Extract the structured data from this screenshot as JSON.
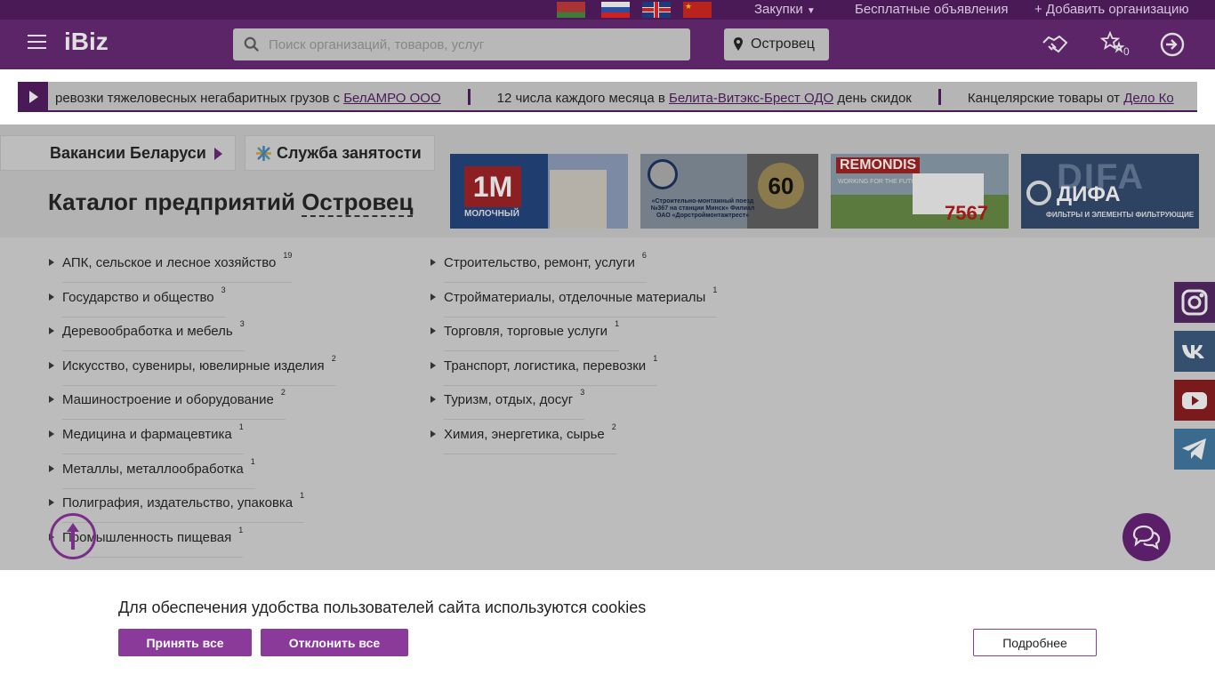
{
  "top_nav": {
    "flags": [
      "Беларусь",
      "Россия",
      "Великобритания",
      "Китай"
    ],
    "purchases": "Закупки",
    "free_ads": "Бесплатные объявления",
    "add_org": "+ Добавить организацию"
  },
  "header": {
    "logo": "iBiz",
    "search_placeholder": "Поиск организаций, товаров, услуг",
    "city": "Островец",
    "favorites_count": "0"
  },
  "ticker": {
    "items": [
      {
        "pre": "ревозки тяжеловесных негабаритных грузов с ",
        "link": "БелАМРО ООО",
        "post": ""
      },
      {
        "pre": "12 числа каждого месяца в ",
        "link": "Белита-Витэкс-Брест ОДО",
        "post": " день скидок"
      },
      {
        "pre": "Канцелярские товары от ",
        "link": "Дело Ко",
        "post": ""
      }
    ]
  },
  "tabs": {
    "jobs": "Вакансии Беларуси",
    "employment": "Служба занятости"
  },
  "page": {
    "title_prefix": "Каталог предприятий",
    "title_city": "Островец"
  },
  "banners": {
    "b1": {
      "mark": "1М",
      "caption": "МОЛОЧНЫЙ"
    },
    "b2": {
      "text": "«Строительно-монтажный поезд №367 на станции Минск» Филиал ОАО «Дорстроймонтажтрест»",
      "badge": "60"
    },
    "b3": {
      "brand": "REMONDIS",
      "sub": "WORKING FOR THE FUTURE",
      "number": "7567"
    },
    "b4": {
      "big": "DIFA",
      "name": "ДИФА",
      "sub": "ФИЛЬТРЫ И ЭЛЕМЕНТЫ ФИЛЬТРУЮЩИЕ"
    }
  },
  "catalog": {
    "col1": [
      {
        "label": "АПК, сельское и лесное хозяйство",
        "count": "19"
      },
      {
        "label": "Государство и общество",
        "count": "3"
      },
      {
        "label": "Деревообработка и мебель",
        "count": "3"
      },
      {
        "label": "Искусство, сувениры, ювелирные изделия",
        "count": "2"
      },
      {
        "label": "Машиностроение и оборудование",
        "count": "2"
      },
      {
        "label": "Медицина и фармацевтика",
        "count": "1"
      },
      {
        "label": "Металлы, металлообработка",
        "count": "1"
      },
      {
        "label": "Полиграфия, издательство, упаковка",
        "count": "1"
      },
      {
        "label": "Промышленность пищевая",
        "count": "1"
      }
    ],
    "col2": [
      {
        "label": "Строительство, ремонт, услуги",
        "count": "6"
      },
      {
        "label": "Стройматериалы, отделочные материалы",
        "count": "1"
      },
      {
        "label": "Торговля, торговые услуги",
        "count": "1"
      },
      {
        "label": "Транспорт, логистика, перевозки",
        "count": "1"
      },
      {
        "label": "Туризм, отдых, досуг",
        "count": "3"
      },
      {
        "label": "Химия, энергетика, сырье",
        "count": "2"
      }
    ]
  },
  "social": [
    "instagram-icon",
    "vk-icon",
    "youtube-icon",
    "telegram-icon"
  ],
  "cookie": {
    "text": "Для обеспечения удобства пользователей сайта используются cookies",
    "accept": "Принять все",
    "decline": "Отклонить все",
    "more": "Подробнее"
  },
  "colors": {
    "brand_purple": "#5b2568",
    "button_purple": "#8a3b9a"
  }
}
